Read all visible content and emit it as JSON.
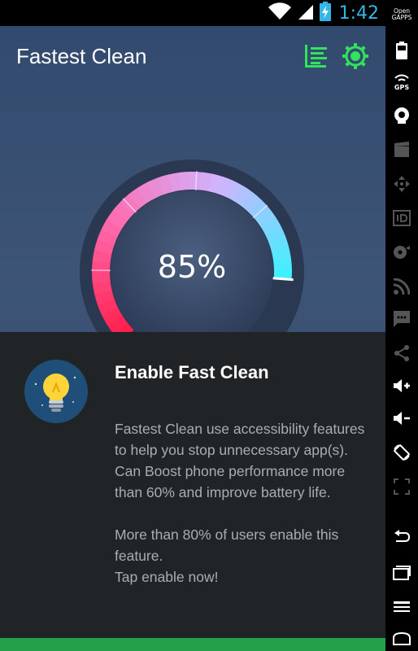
{
  "status_bar": {
    "time": "1:42",
    "icons": [
      "wifi-icon",
      "signal-icon",
      "battery-charging-icon"
    ]
  },
  "app": {
    "title": "Fastest Clean",
    "actions": [
      "list-menu-icon",
      "settings-gear-icon"
    ],
    "gauge": {
      "value_text": "85%",
      "level": 0.85
    }
  },
  "dialog": {
    "title": "Enable Fast Clean",
    "paragraph1": "Fastest Clean use accessibility features to help you stop unnecessary app(s). Can Boost phone performance more than 60% and improve battery life.",
    "paragraph2": "More than 80% of users enable this feature.\nTap enable now!"
  },
  "side_toolbar": {
    "gapps_label": "Open\nGAPPS",
    "gps_label": "GPS",
    "items": [
      "battery-icon",
      "gps-icon",
      "camera-icon",
      "clapperboard-icon",
      "dpad-icon",
      "id-icon",
      "disk-icon",
      "rss-icon",
      "sms-icon",
      "share-icon",
      "volume-up-icon",
      "volume-down-icon",
      "rotate-icon",
      "fullscreen-icon",
      "back-icon",
      "recents-icon",
      "menu-icon",
      "home-icon"
    ]
  },
  "colors": {
    "gauge_red": "#ff1f4d",
    "gauge_pink": "#ff6bb0",
    "gauge_lavender": "#d1b3ff",
    "gauge_cyan": "#3ff0ff",
    "accent_green": "#31e35a",
    "enable_bar": "#24a148"
  }
}
